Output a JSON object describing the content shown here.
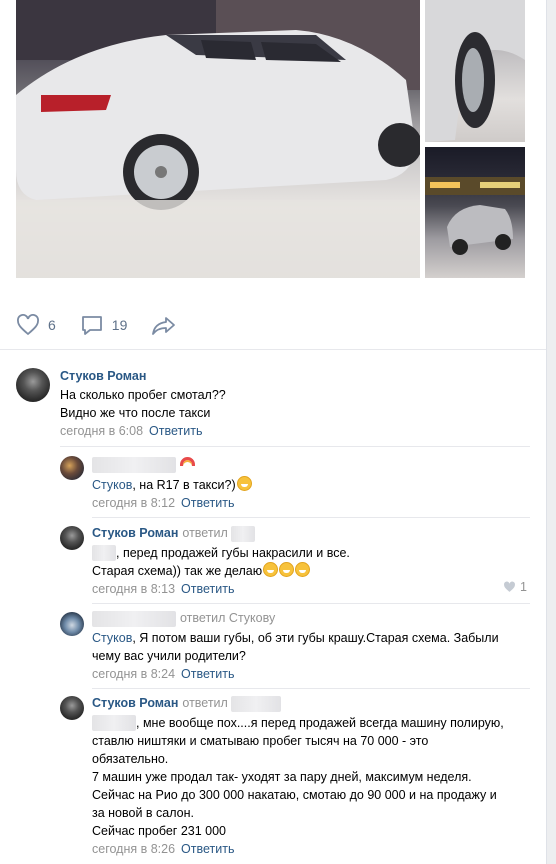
{
  "post": {
    "photos": [
      {
        "alt": ""
      },
      {
        "alt": ""
      },
      {
        "alt": ""
      }
    ],
    "actions": {
      "likes": "6",
      "comments": "19"
    }
  },
  "comments": [
    {
      "author": "Стуков Роман",
      "lines": [
        "На сколько пробег смотал??",
        "Видно же что после такси"
      ],
      "time": "сегодня в 6:08",
      "reply": "Ответить"
    },
    {
      "author": "",
      "mention": "Стуков",
      "text": ", на R17 в такси?)",
      "time": "сегодня в 8:12",
      "reply": "Ответить"
    },
    {
      "author": "Стуков Роман",
      "replied": "ответил",
      "line1": ", перед продажей губы накрасили и все.",
      "line2": "Старая схема)) так же делаю",
      "time": "сегодня в 8:13",
      "reply": "Ответить",
      "likes": "1"
    },
    {
      "author": "",
      "replied": "ответил Стукову",
      "mention": "Стуков",
      "line1": ", Я потом ваши губы, об эти губы крашу.Старая схема. Забыли",
      "line2": "чему вас учили родители?",
      "time": "сегодня в 8:24",
      "reply": "Ответить"
    },
    {
      "author": "Стуков Роман",
      "replied": "ответил",
      "lines": [
        ", мне вообще пох....я перед продажей всегда машину полирую,",
        "ставлю ништяки и сматываю пробег тысяч на 70 000 - это",
        "обязательно.",
        "7 машин уже продал так- уходят за пару дней, максимум неделя.",
        "Сейчас на Рио до 300 000 накатаю, смотаю до 90 000 и на продажу и",
        "за новой в салон.",
        "Сейчас пробег 231 000"
      ],
      "time": "сегодня в 8:26",
      "reply": "Ответить"
    }
  ],
  "colors": {
    "link": "#2a5885",
    "meta": "#939393",
    "action": "#5e7189"
  }
}
